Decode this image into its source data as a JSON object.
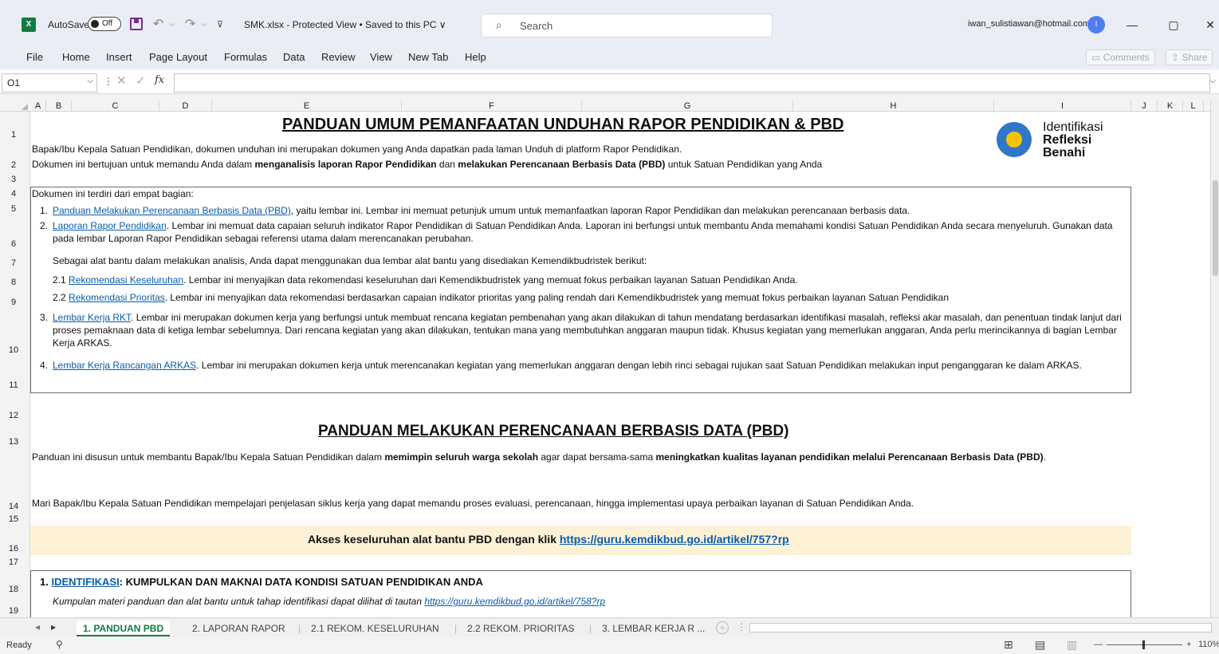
{
  "titlebar": {
    "autosave_label": "AutoSave",
    "autosave_state": "Off",
    "document_title": "SMK.xlsx  -  Protected View • Saved to this PC ∨",
    "search_placeholder": "Search",
    "user_email": "iwan_sulistiawan@hotmail.com",
    "avatar_initial": "I",
    "minimize": "—",
    "restore": "▢",
    "close": "✕"
  },
  "menu": {
    "items": [
      "File",
      "Home",
      "Insert",
      "Page Layout",
      "Formulas",
      "Data",
      "Review",
      "View",
      "New Tab",
      "Help"
    ],
    "comments": "Comments",
    "share": "Share"
  },
  "formula_bar": {
    "name_box": "O1",
    "formula": ""
  },
  "columns": [
    "A",
    "B",
    "C",
    "D",
    "E",
    "F",
    "G",
    "H",
    "I",
    "J",
    "K",
    "L"
  ],
  "rows": [
    "1",
    "2",
    "3",
    "4",
    "5",
    "6",
    "7",
    "8",
    "9",
    "10",
    "11",
    "12",
    "13",
    "14",
    "15",
    "16",
    "17",
    "18",
    "19"
  ],
  "content": {
    "title1": "PANDUAN UMUM PEMANFAATAN UNDUHAN RAPOR PENDIDIKAN & PBD",
    "logo": {
      "line1": "Identifikasi",
      "line2": "Refleksi",
      "line3": "Benahi"
    },
    "intro1": "Bapak/Ibu Kepala Satuan Pendidikan, dokumen unduhan ini merupakan dokumen yang Anda dapatkan pada laman Unduh di platform Rapor Pendidikan.",
    "intro2_a": "Dokumen ini bertujuan untuk memandu Anda dalam ",
    "intro2_b": "menganalisis laporan Rapor Pendidikan",
    "intro2_c": " dan ",
    "intro2_d": "melakukan Perencanaan Berbasis Data (PBD)",
    "intro2_e": " untuk Satuan Pendidikan yang Anda",
    "box_intro": "Dokumen ini terdiri dari empat bagian:",
    "item1_num": "1.",
    "item1_link": "Panduan Melakukan Perencanaan Berbasis Data (PBD)",
    "item1_text": ", yaitu lembar ini. Lembar ini memuat petunjuk umum untuk memanfaatkan laporan Rapor Pendidikan dan melakukan perencanaan berbasis data.",
    "item2_num": "2.",
    "item2_link": "Laporan Rapor Pendidikan",
    "item2_text": ". Lembar ini memuat data capaian seluruh indikator Rapor Pendidikan di Satuan Pendidikan Anda. Laporan ini berfungsi untuk membantu Anda memahami kondisi Satuan Pendidikan Anda secara menyeluruh. Gunakan data pada lembar Laporan Rapor Pendidikan sebagai referensi utama dalam merencanakan perubahan.",
    "item2_sub": "Sebagai alat bantu dalam melakukan analisis, Anda dapat menggunakan dua lembar alat bantu yang disediakan Kemendikbudristek berikut:",
    "item21_num": "2.1",
    "item21_link": "Rekomendasi Keseluruhan",
    "item21_text": ". Lembar ini menyajikan data rekomendasi keseluruhan dari Kemendikbudristek yang memuat fokus perbaikan layanan Satuan Pendidikan Anda.",
    "item22_num": "2.2",
    "item22_link": "Rekomendasi Prioritas",
    "item22_text": ". Lembar ini menyajikan data rekomendasi berdasarkan capaian indikator prioritas yang paling rendah dari Kemendikbudristek yang memuat fokus perbaikan layanan Satuan Pendidikan",
    "item3_num": "3.",
    "item3_link": "Lembar Kerja RKT",
    "item3_text": ". Lembar ini merupakan dokumen kerja yang berfungsi untuk membuat rencana kegiatan pembenahan yang akan dilakukan di tahun mendatang berdasarkan identifikasi masalah, refleksi akar masalah, dan penentuan tindak lanjut dari proses pemaknaan data di ketiga lembar sebelumnya. Dari rencana kegiatan yang akan dilakukan, tentukan mana yang membutuhkan anggaran maupun tidak. Khusus kegiatan yang memerlukan anggaran, Anda perlu merincikannya di bagian Lembar Kerja ARKAS.",
    "item4_num": "4.",
    "item4_link": "Lembar Kerja Rancangan ARKAS",
    "item4_text": ". Lembar ini merupakan dokumen kerja untuk merencanakan kegiatan yang memerlukan anggaran dengan lebih rinci sebagai rujukan saat Satuan Pendidikan melakukan input penganggaran ke dalam ARKAS.",
    "title2": "PANDUAN MELAKUKAN PERENCANAAN BERBASIS DATA (PBD)",
    "p13_a": "Panduan ini disusun untuk membantu Bapak/Ibu Kepala Satuan Pendidikan dalam ",
    "p13_b": "memimpin seluruh warga sekolah",
    "p13_c": " agar dapat bersama-sama ",
    "p13_d": "meningkatkan kualitas layanan pendidikan melalui Perencanaan Berbasis Data (PBD)",
    "p13_e": ".",
    "p14": "Mari Bapak/Ibu Kepala Satuan Pendidikan mempelajari penjelasan siklus kerja yang dapat memandu proses evaluasi, perencanaan, hingga implementasi upaya perbaikan layanan di Satuan Pendidikan Anda.",
    "akses_text": "Akses keseluruhan alat bantu PBD dengan klik ",
    "akses_link": "https://guru.kemdikbud.go.id/artikel/757?rp",
    "sec1_num": "1. ",
    "sec1_link": "IDENTIFIKASI",
    "sec1_text": ": KUMPULKAN DAN MAKNAI DATA KONDISI SATUAN PENDIDIKAN ANDA",
    "sec1_sub": "Kumpulan materi panduan dan alat bantu untuk tahap identifikasi dapat dilihat di tautan ",
    "sec1_sub_link": "https://guru.kemdikbud.go.id/artikel/758?rp"
  },
  "sheet_tabs": [
    "1. PANDUAN PBD",
    "2. LAPORAN RAPOR",
    "2.1 REKOM. KESELURUHAN",
    "2.2 REKOM. PRIORITAS",
    "3. LEMBAR KERJA R ..."
  ],
  "status": {
    "ready": "Ready",
    "zoom": "110%"
  }
}
